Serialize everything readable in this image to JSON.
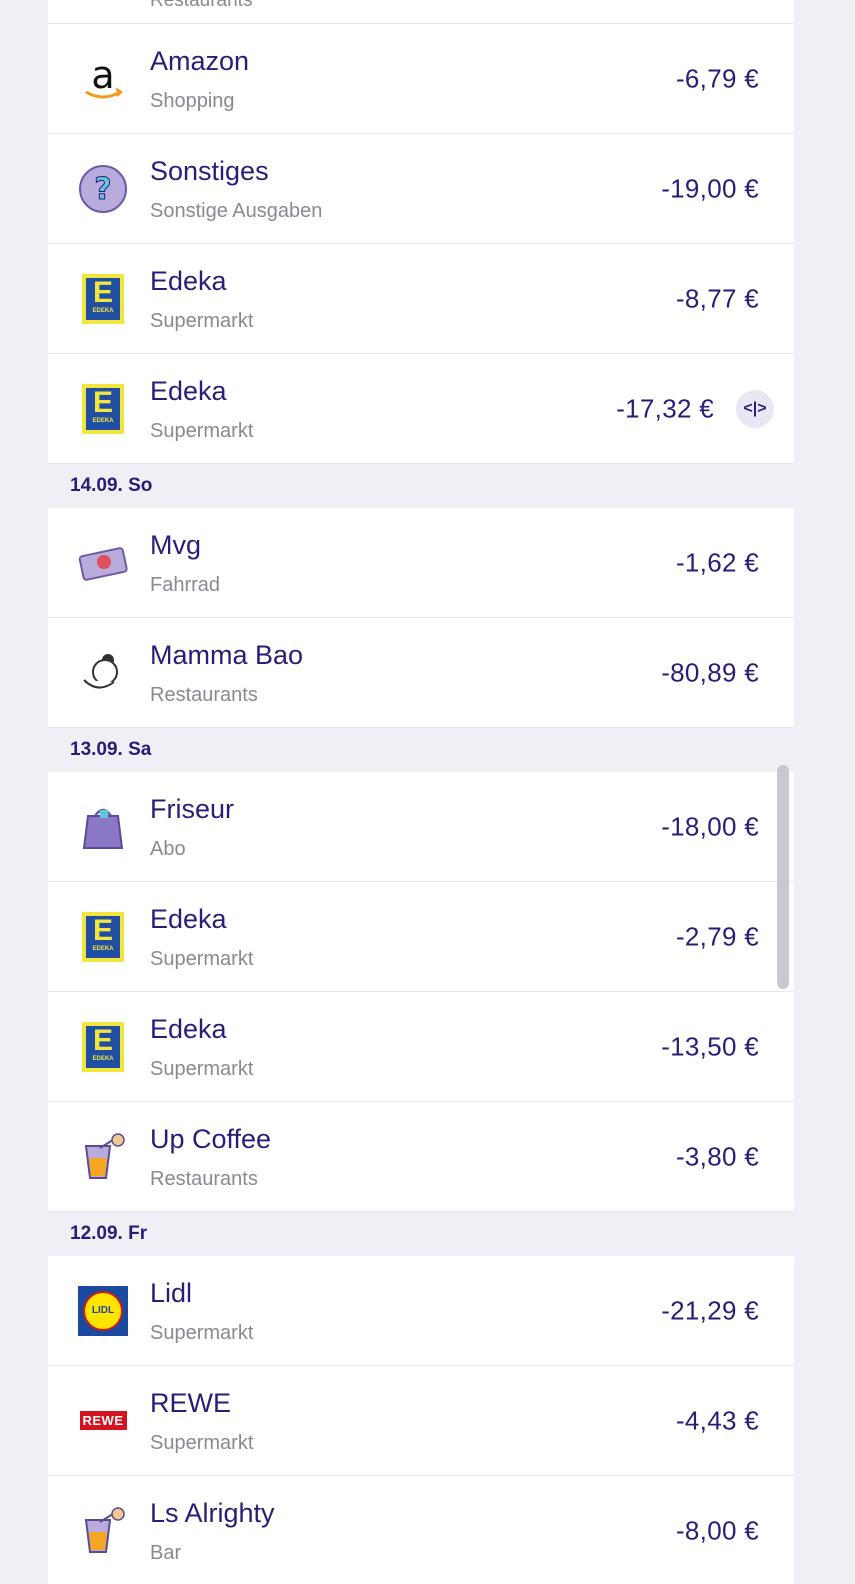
{
  "top_partial": {
    "category": "Restaurants"
  },
  "groups": [
    {
      "date": "",
      "rows": [
        {
          "name": "Amazon",
          "category": "Shopping",
          "amount": "-6,79 €",
          "logo": "amazon-logo"
        },
        {
          "name": "Sonstiges",
          "category": "Sonstige Ausgaben",
          "amount": "-19,00 €",
          "logo": "question-icon"
        },
        {
          "name": "Edeka",
          "category": "Supermarkt",
          "amount": "-8,77 €",
          "logo": "edeka-logo"
        },
        {
          "name": "Edeka",
          "category": "Supermarkt",
          "amount": "-17,32 €",
          "logo": "edeka-logo",
          "split": true
        }
      ]
    },
    {
      "date": "14.09. So",
      "rows": [
        {
          "name": "Mvg",
          "category": "Fahrrad",
          "amount": "-1,62 €",
          "logo": "ticket-icon"
        },
        {
          "name": "Mamma Bao",
          "category": "Restaurants",
          "amount": "-80,89 €",
          "logo": "mamma-bao-logo"
        }
      ]
    },
    {
      "date": "13.09. Sa",
      "rows": [
        {
          "name": "Friseur",
          "category": "Abo",
          "amount": "-18,00 €",
          "logo": "shopping-bag-icon"
        },
        {
          "name": "Edeka",
          "category": "Supermarkt",
          "amount": "-2,79 €",
          "logo": "edeka-logo"
        },
        {
          "name": "Edeka",
          "category": "Supermarkt",
          "amount": "-13,50 €",
          "logo": "edeka-logo"
        },
        {
          "name": "Up Coffee",
          "category": "Restaurants",
          "amount": "-3,80 €",
          "logo": "drink-icon"
        }
      ]
    },
    {
      "date": "12.09. Fr",
      "rows": [
        {
          "name": "Lidl",
          "category": "Supermarkt",
          "amount": "-21,29 €",
          "logo": "lidl-logo"
        },
        {
          "name": "REWE",
          "category": "Supermarkt",
          "amount": "-4,43 €",
          "logo": "rewe-logo"
        },
        {
          "name": "Ls Alrighty",
          "category": "Bar",
          "amount": "-8,00 €",
          "logo": "drink-icon"
        }
      ]
    }
  ],
  "logo_text": {
    "edeka": "EDEKA",
    "lidl": "LIDL",
    "rewe": "REWE"
  },
  "split_icon": "<|>",
  "colors": {
    "text_primary": "#2a1d7a",
    "text_secondary": "#8a8894",
    "background": "#f0eff5",
    "row": "#ffffff"
  }
}
